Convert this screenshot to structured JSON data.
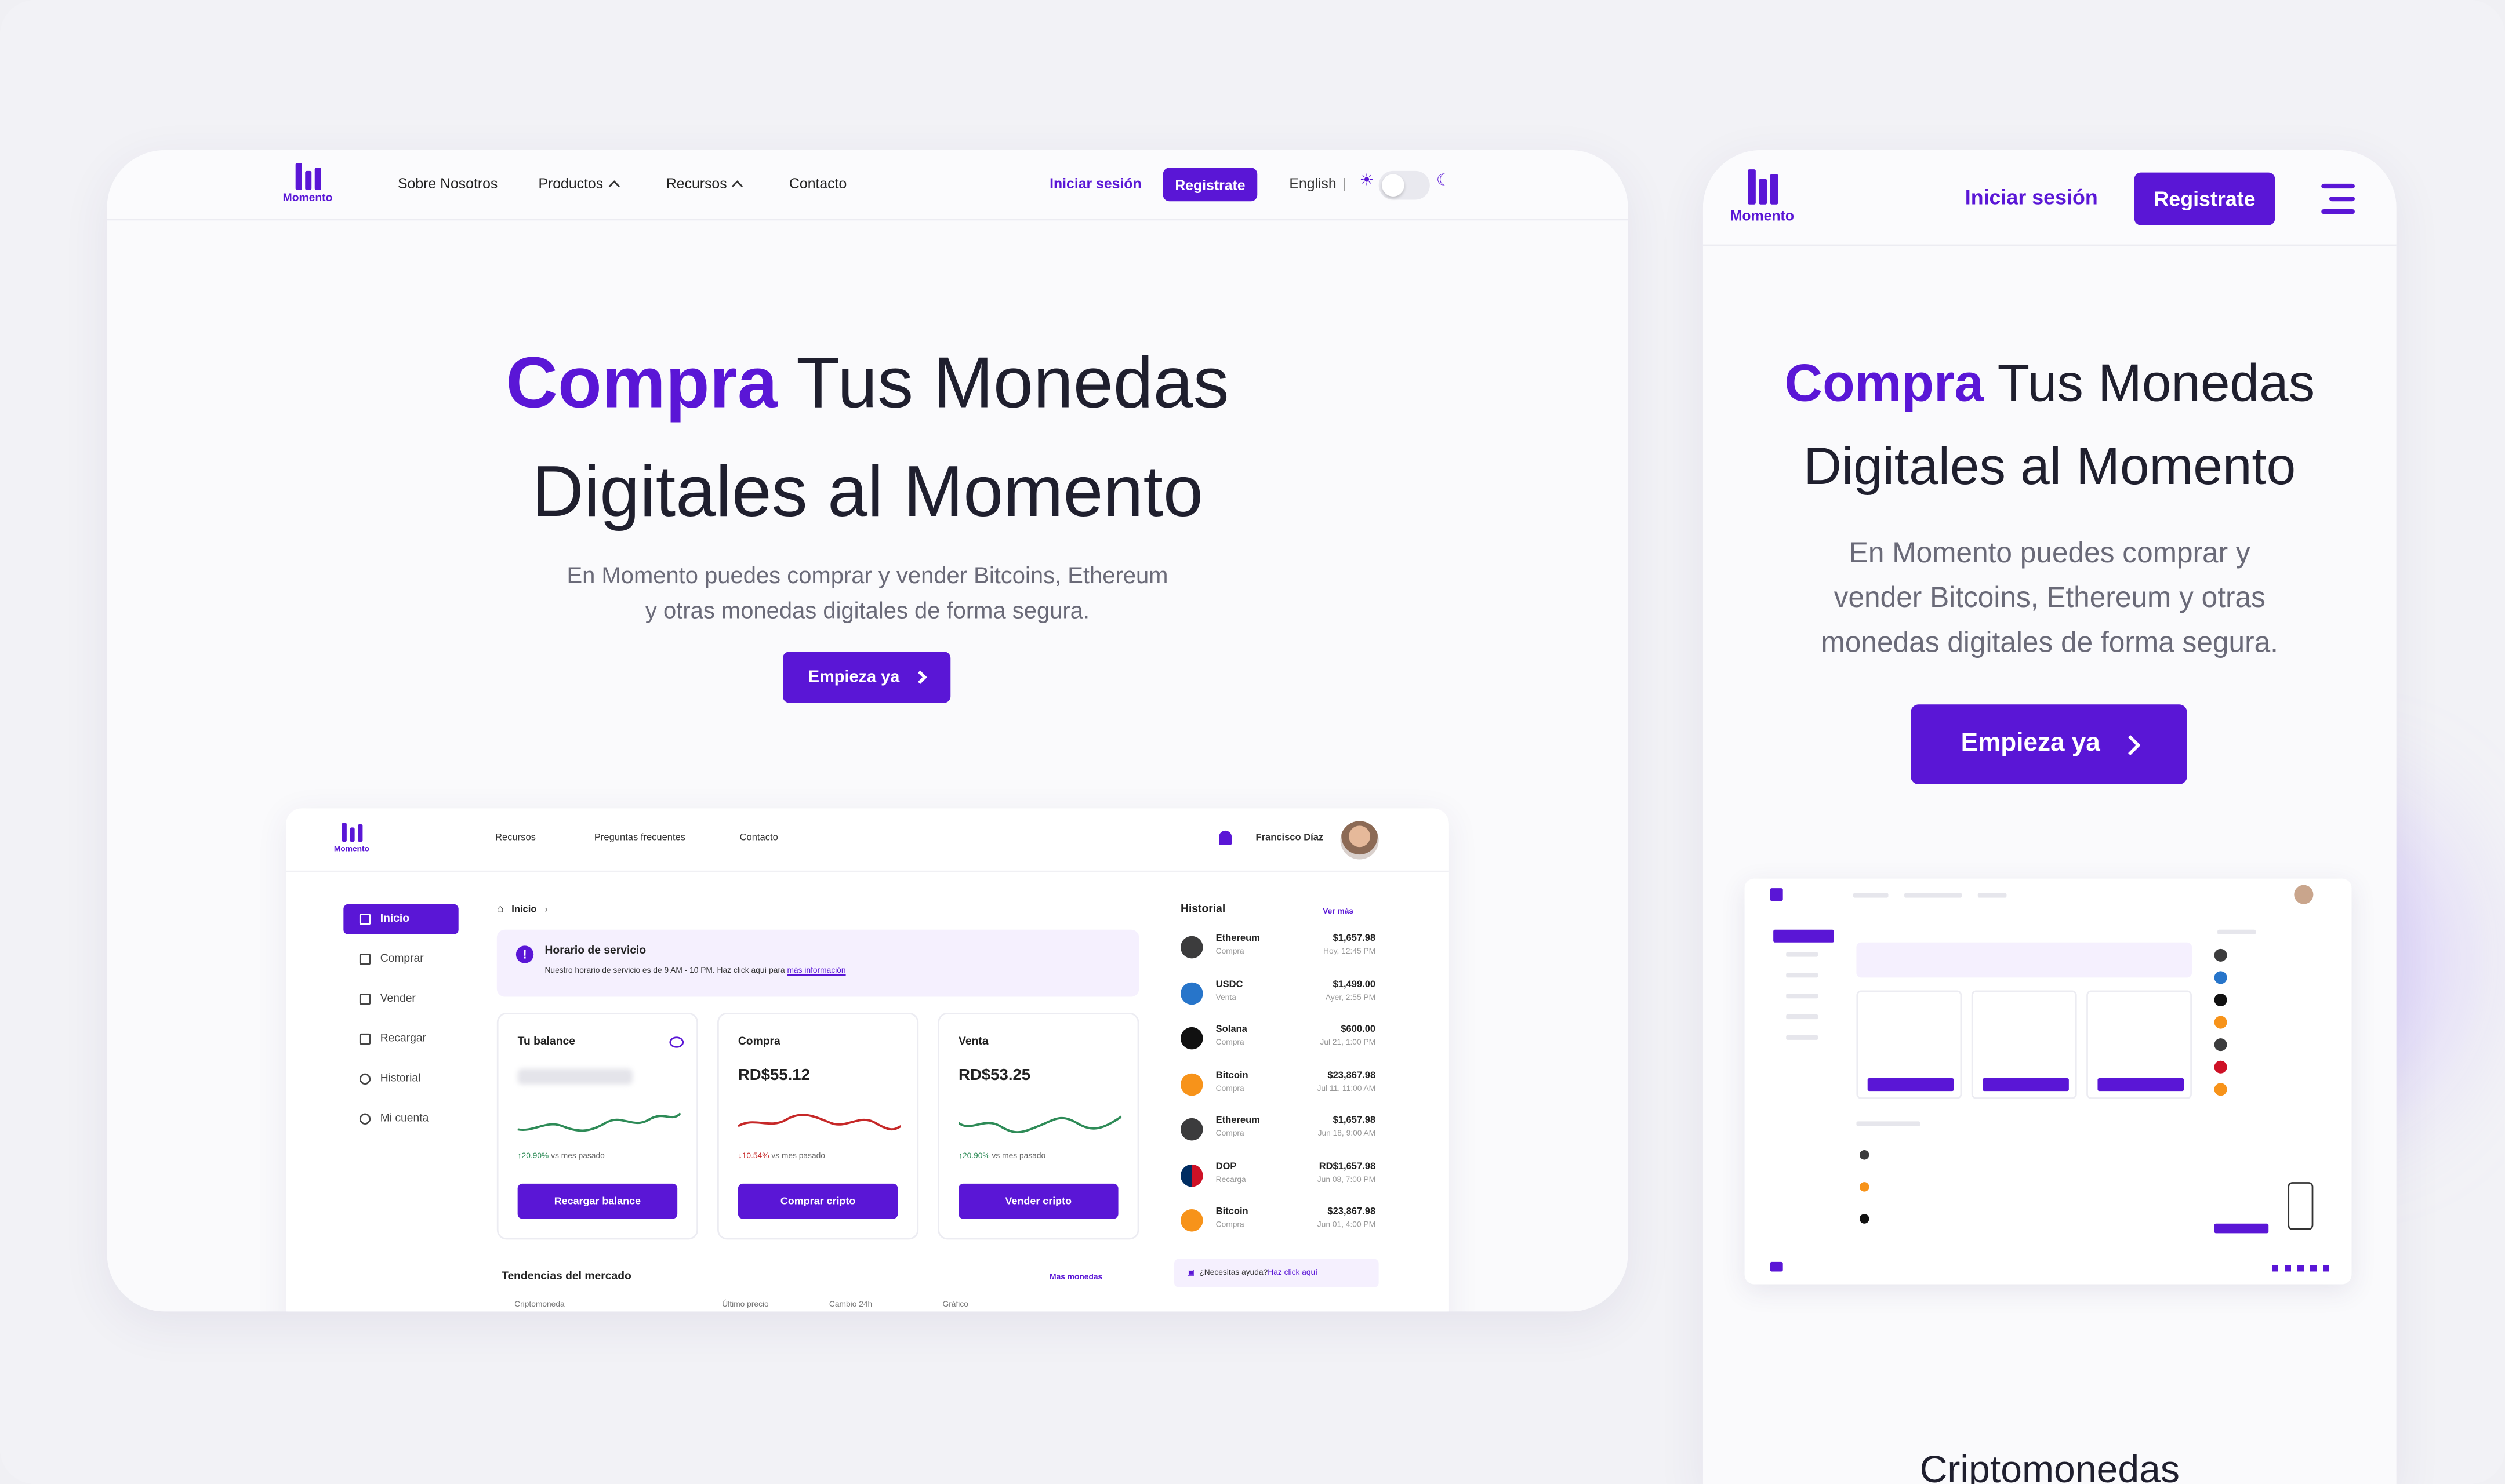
{
  "brand": {
    "name": "Momento",
    "color": "#5a16d6"
  },
  "desktop": {
    "nav": {
      "links": [
        {
          "label": "Sobre Nosotros"
        },
        {
          "label": "Productos"
        },
        {
          "label": "Recursos"
        },
        {
          "label": "Contacto"
        }
      ],
      "login": "Iniciar sesión",
      "register": "Registrate",
      "language": "English"
    },
    "hero": {
      "highlight": "Compra",
      "title_rest": " Tus Monedas",
      "title_line2": "Digitales al Momento",
      "subtitle_line1": "En Momento puedes comprar y vender Bitcoins, Ethereum",
      "subtitle_line2": "y otras monedas digitales de forma segura.",
      "cta": "Empieza ya"
    }
  },
  "dashboard": {
    "nav": {
      "links": [
        "Recursos",
        "Preguntas frecuentes",
        "Contacto"
      ],
      "user": "Francisco Díaz"
    },
    "sidebar": [
      "Inicio",
      "Comprar",
      "Vender",
      "Recargar",
      "Historial",
      "Mi cuenta"
    ],
    "breadcrumb": "Inicio",
    "alert": {
      "title": "Horario de servicio",
      "text": "Nuestro horario de servicio es de 9 AM - 10 PM. Haz click aquí para ",
      "link": "más información"
    },
    "cards": [
      {
        "title": "Tu balance",
        "value": "",
        "change": "20.90%",
        "change_suffix": " vs mes pasado",
        "button": "Recargar balance",
        "trend": "up"
      },
      {
        "title": "Compra",
        "value": "RD$55.12",
        "change": "10.54%",
        "change_suffix": " vs mes pasado",
        "button": "Comprar cripto",
        "trend": "down"
      },
      {
        "title": "Venta",
        "value": "RD$53.25",
        "change": "20.90%",
        "change_suffix": " vs mes pasado",
        "button": "Vender cripto",
        "trend": "up"
      }
    ],
    "history": {
      "title": "Historial",
      "more": "Ver más",
      "items": [
        {
          "name": "Ethereum",
          "type": "Compra",
          "amount": "$1,657.98",
          "date": "Hoy, 12:45 PM",
          "color": "#3c3c3d"
        },
        {
          "name": "USDC",
          "type": "Venta",
          "amount": "$1,499.00",
          "date": "Ayer, 2:55 PM",
          "color": "#2775ca"
        },
        {
          "name": "Solana",
          "type": "Compra",
          "amount": "$600.00",
          "date": "Jul 21, 1:00 PM",
          "color": "#111111"
        },
        {
          "name": "Bitcoin",
          "type": "Compra",
          "amount": "$23,867.98",
          "date": "Jul 11, 11:00 AM",
          "color": "#f7931a"
        },
        {
          "name": "Ethereum",
          "type": "Compra",
          "amount": "$1,657.98",
          "date": "Jun 18, 9:00 AM",
          "color": "#3c3c3d"
        },
        {
          "name": "DOP",
          "type": "Recarga",
          "amount": "RD$1,657.98",
          "date": "Jun 08, 7:00 PM",
          "color": "#ce1126"
        },
        {
          "name": "Bitcoin",
          "type": "Compra",
          "amount": "$23,867.98",
          "date": "Jun 01, 4:00 PM",
          "color": "#f7931a"
        }
      ]
    },
    "help": {
      "text": "¿Necesitas ayuda? ",
      "link": "Haz click aquí"
    },
    "market": {
      "title": "Tendencias del mercado",
      "more": "Mas monedas",
      "columns": [
        "Criptomoneda",
        "Último precio",
        "Cambio 24h",
        "Gráfico"
      ]
    }
  },
  "mobile": {
    "login": "Iniciar sesión",
    "register": "Registrate",
    "hero": {
      "highlight": "Compra",
      "title_rest": " Tus Monedas",
      "title_line2": "Digitales al Momento",
      "subtitle_line1": "En Momento puedes comprar y",
      "subtitle_line2": "vender Bitcoins, Ethereum y otras",
      "subtitle_line3": "monedas digitales de forma segura.",
      "cta": "Empieza ya"
    },
    "next_section": "Criptomonedas"
  }
}
